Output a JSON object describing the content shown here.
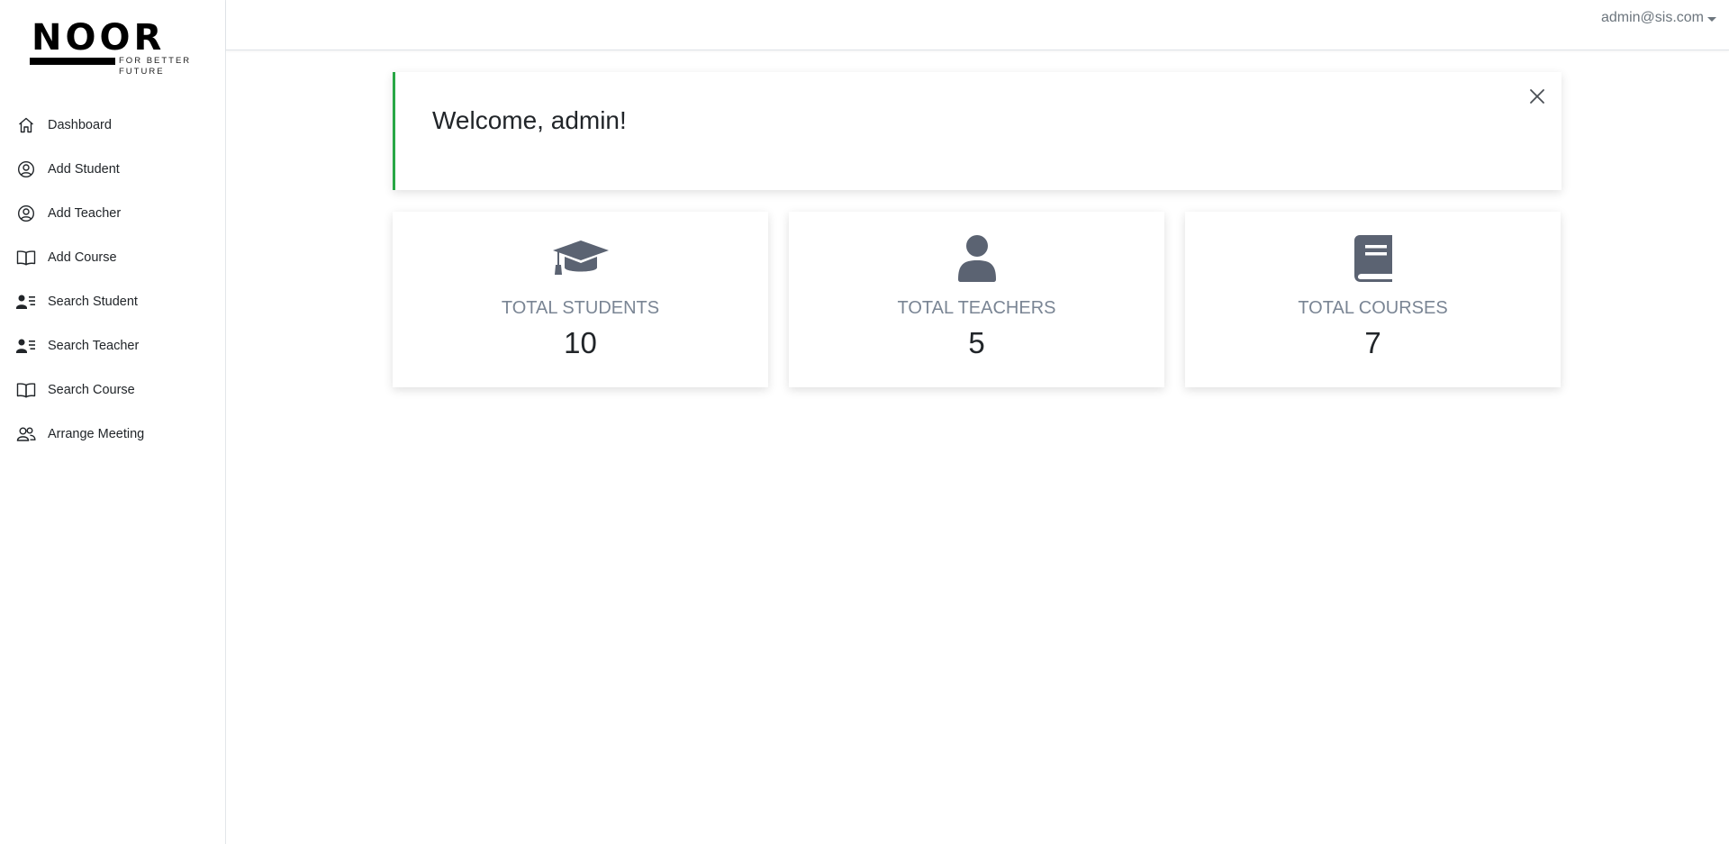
{
  "brand": {
    "name": "NOOR",
    "tagline": "FOR BETTER FUTURE"
  },
  "sidebar": {
    "items": [
      {
        "label": "Dashboard",
        "icon": "home-icon"
      },
      {
        "label": "Add Student",
        "icon": "user-circle-icon"
      },
      {
        "label": "Add Teacher",
        "icon": "user-circle-icon"
      },
      {
        "label": "Add Course",
        "icon": "book-open-icon"
      },
      {
        "label": "Search Student",
        "icon": "user-list-icon"
      },
      {
        "label": "Search Teacher",
        "icon": "user-list-icon"
      },
      {
        "label": "Search Course",
        "icon": "book-open-icon"
      },
      {
        "label": "Arrange Meeting",
        "icon": "people-icon"
      }
    ]
  },
  "header": {
    "user_email": "admin@sis.com"
  },
  "alert": {
    "message": "Welcome, admin!",
    "accent_color": "#28a745"
  },
  "stats": [
    {
      "label": "TOTAL STUDENTS",
      "value": "10",
      "icon": "graduation-cap-icon"
    },
    {
      "label": "TOTAL TEACHERS",
      "value": "5",
      "icon": "user-icon"
    },
    {
      "label": "TOTAL COURSES",
      "value": "7",
      "icon": "book-icon"
    }
  ],
  "colors": {
    "icon_gray": "#5b6372",
    "label_gray": "#7a8594"
  }
}
